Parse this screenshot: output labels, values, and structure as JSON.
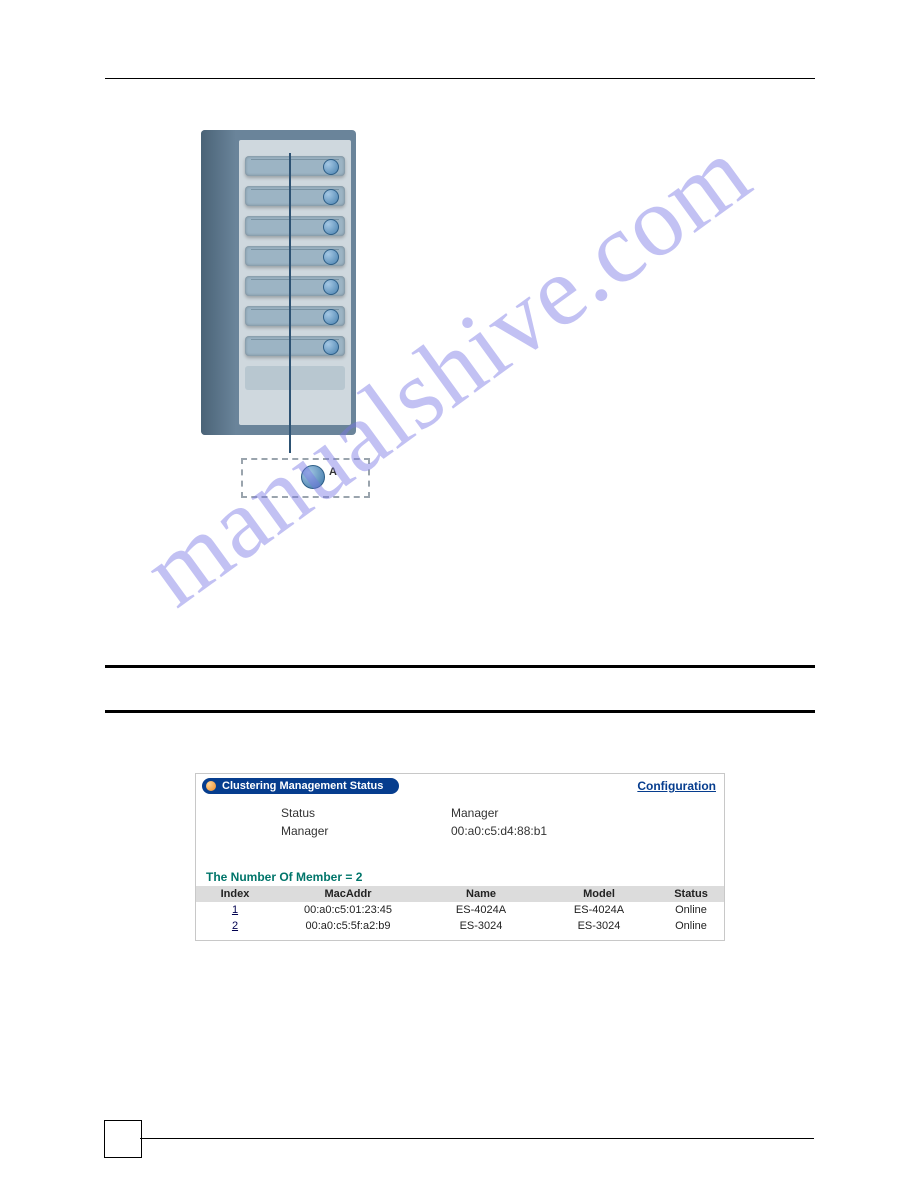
{
  "figure": {
    "external_label": "A"
  },
  "panel": {
    "title": "Clustering Management Status",
    "config_link": "Configuration",
    "status_label": "Status",
    "status_value": "Manager",
    "manager_label": "Manager",
    "manager_value": "00:a0:c5:d4:88:b1",
    "count_label": "The Number Of Member = 2",
    "columns": {
      "index": "Index",
      "mac": "MacAddr",
      "name": "Name",
      "model": "Model",
      "status": "Status"
    },
    "members": [
      {
        "index": "1",
        "mac": "00:a0:c5:01:23:45",
        "name": "ES-4024A",
        "model": "ES-4024A",
        "status": "Online"
      },
      {
        "index": "2",
        "mac": "00:a0:c5:5f:a2:b9",
        "name": "ES-3024",
        "model": "ES-3024",
        "status": "Online"
      }
    ]
  },
  "watermark": "manualshive.com"
}
